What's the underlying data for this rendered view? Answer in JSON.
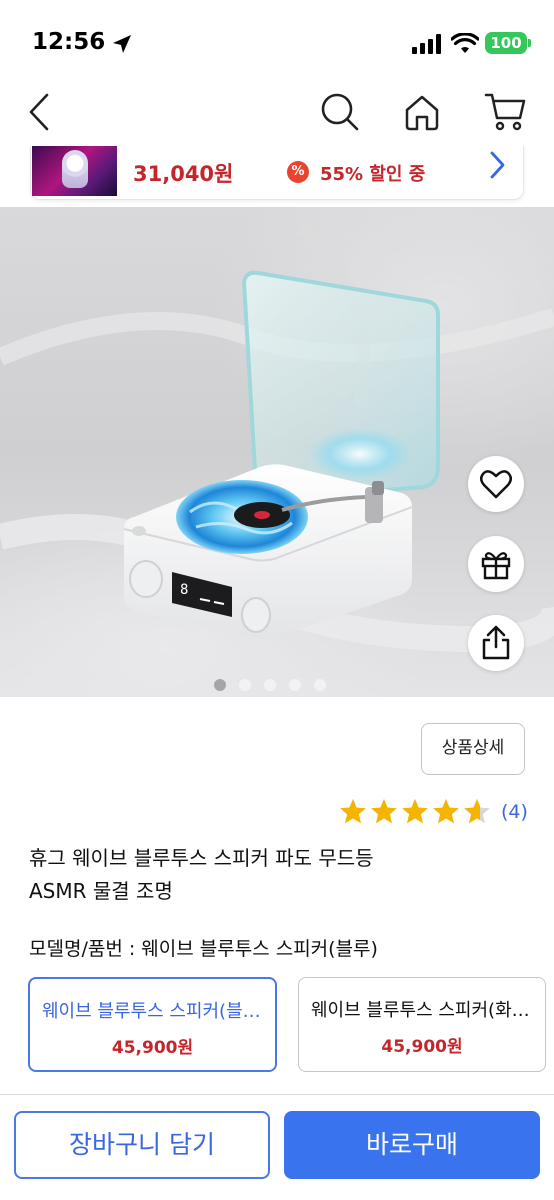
{
  "status_bar": {
    "time": "12:56",
    "battery": "100"
  },
  "nav": {
    "icons": [
      "back-icon",
      "search-icon",
      "home-icon",
      "cart-icon"
    ]
  },
  "promo": {
    "price": "31,040원",
    "badge": "%",
    "discount": "55% 할인 중"
  },
  "gallery": {
    "total": 5,
    "active_index": 0
  },
  "product": {
    "detail_button": "상품상세",
    "rating_value": 4.6,
    "rating_count": "(4)",
    "title_line1": "휴그 웨이브 블루투스 스피커 파도 무드등",
    "title_line2": "ASMR 물결 조명",
    "option_label": "모델명/품번 : 웨이브 블루투스 스피커(블루)",
    "options": [
      {
        "name": "웨이브 블루투스 스피커(블루)",
        "price": "45,900원",
        "selected": true
      },
      {
        "name": "웨이브 블루투스 스피커(화이트)",
        "price": "45,900원",
        "selected": false
      }
    ]
  },
  "actions": {
    "cart": "장바구니 담기",
    "buy": "바로구매"
  },
  "colors": {
    "accent": "#3a73ee",
    "price_red": "#c4262b",
    "star": "#f5b400"
  }
}
